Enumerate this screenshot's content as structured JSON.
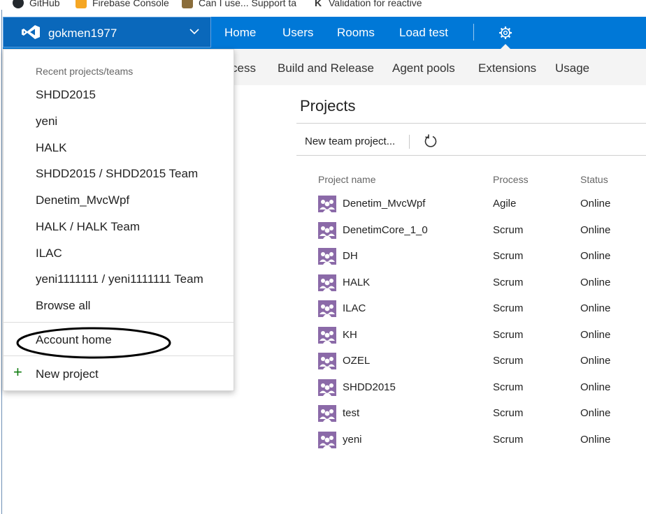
{
  "bookmarks": [
    {
      "label": "GitHub",
      "color": "#24292e"
    },
    {
      "label": "Firebase Console",
      "color": "#f5a623"
    },
    {
      "label": "Can I use... Support ta",
      "color": "#8a6d3b"
    },
    {
      "label": "Validation for reactive",
      "color": "#333333"
    }
  ],
  "header": {
    "account_name": "gokmen1977",
    "nav": [
      "Home",
      "Users",
      "Rooms",
      "Load test"
    ],
    "settings_icon": "gear-icon",
    "accent_color": "#0078d7"
  },
  "subnav": [
    "cess",
    "Build and Release",
    "Agent pools",
    "Extensions",
    "Usage"
  ],
  "dropdown": {
    "heading": "Recent projects/teams",
    "recent": [
      "SHDD2015",
      "yeni",
      "HALK",
      "SHDD2015 / SHDD2015 Team",
      "Denetim_MvcWpf",
      "HALK / HALK Team",
      "ILAC",
      "yeni1111111 / yeni1111111 Team"
    ],
    "browse_all": "Browse all",
    "account_home": "Account home",
    "new_project": "New project"
  },
  "projects": {
    "title": "Projects",
    "new_team_project": "New team project...",
    "columns": [
      "Project name",
      "Process",
      "Status"
    ],
    "rows": [
      {
        "name": "Denetim_MvcWpf",
        "process": "Agile",
        "status": "Online"
      },
      {
        "name": "DenetimCore_1_0",
        "process": "Scrum",
        "status": "Online"
      },
      {
        "name": "DH",
        "process": "Scrum",
        "status": "Online"
      },
      {
        "name": "HALK",
        "process": "Scrum",
        "status": "Online"
      },
      {
        "name": "ILAC",
        "process": "Scrum",
        "status": "Online"
      },
      {
        "name": "KH",
        "process": "Scrum",
        "status": "Online"
      },
      {
        "name": "OZEL",
        "process": "Scrum",
        "status": "Online"
      },
      {
        "name": "SHDD2015",
        "process": "Scrum",
        "status": "Online"
      },
      {
        "name": "test",
        "process": "Scrum",
        "status": "Online"
      },
      {
        "name": "yeni",
        "process": "Scrum",
        "status": "Online"
      }
    ],
    "project_icon_color": "#8b6aa8"
  }
}
